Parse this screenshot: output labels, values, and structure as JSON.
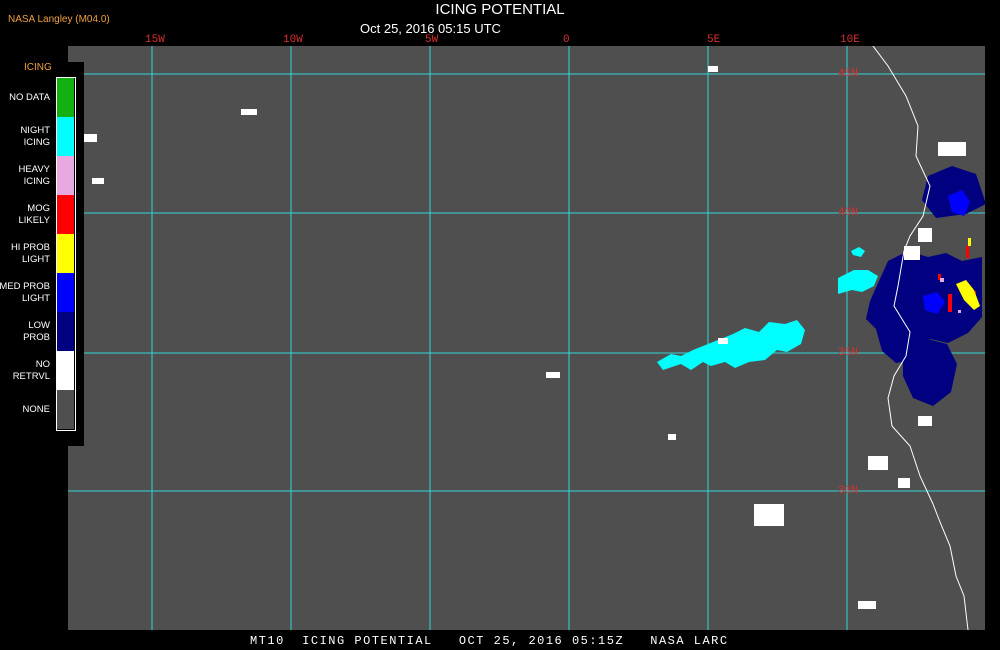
{
  "header": {
    "source": "NASA Langley (M04.0)",
    "title": "ICING POTENTIAL",
    "time": "Oct 25, 2016 05:15 UTC"
  },
  "map": {
    "background_color": "#4f4f4f",
    "grid_color": "#33d6d6",
    "coastline_color": "#ffffff",
    "longitude_labels": [
      "15W",
      "10W",
      "5W",
      "0",
      "5E",
      "10E"
    ],
    "latitude_labels": [
      "45N",
      "40N",
      "35N",
      "30N"
    ]
  },
  "legend": {
    "title": "ICING",
    "items": [
      {
        "label": "NO DATA",
        "color": "#12b012"
      },
      {
        "label": "NIGHT\nICING",
        "color": "#00ffff"
      },
      {
        "label": "HEAVY\nICING",
        "color": "#e8a8e0"
      },
      {
        "label": "MOG\nLIKELY",
        "color": "#ff0000"
      },
      {
        "label": "HI PROB\nLIGHT",
        "color": "#ffff00"
      },
      {
        "label": "MED PROB\nLIGHT",
        "color": "#0000ff"
      },
      {
        "label": "LOW\nPROB",
        "color": "#000080"
      },
      {
        "label": "NO\nRETRVL",
        "color": "#ffffff"
      },
      {
        "label": "NONE",
        "color": "#4f4f4f"
      }
    ]
  },
  "footer": {
    "text": "MT10  ICING POTENTIAL   OCT 25, 2016 05:15Z   NASA LARC"
  }
}
